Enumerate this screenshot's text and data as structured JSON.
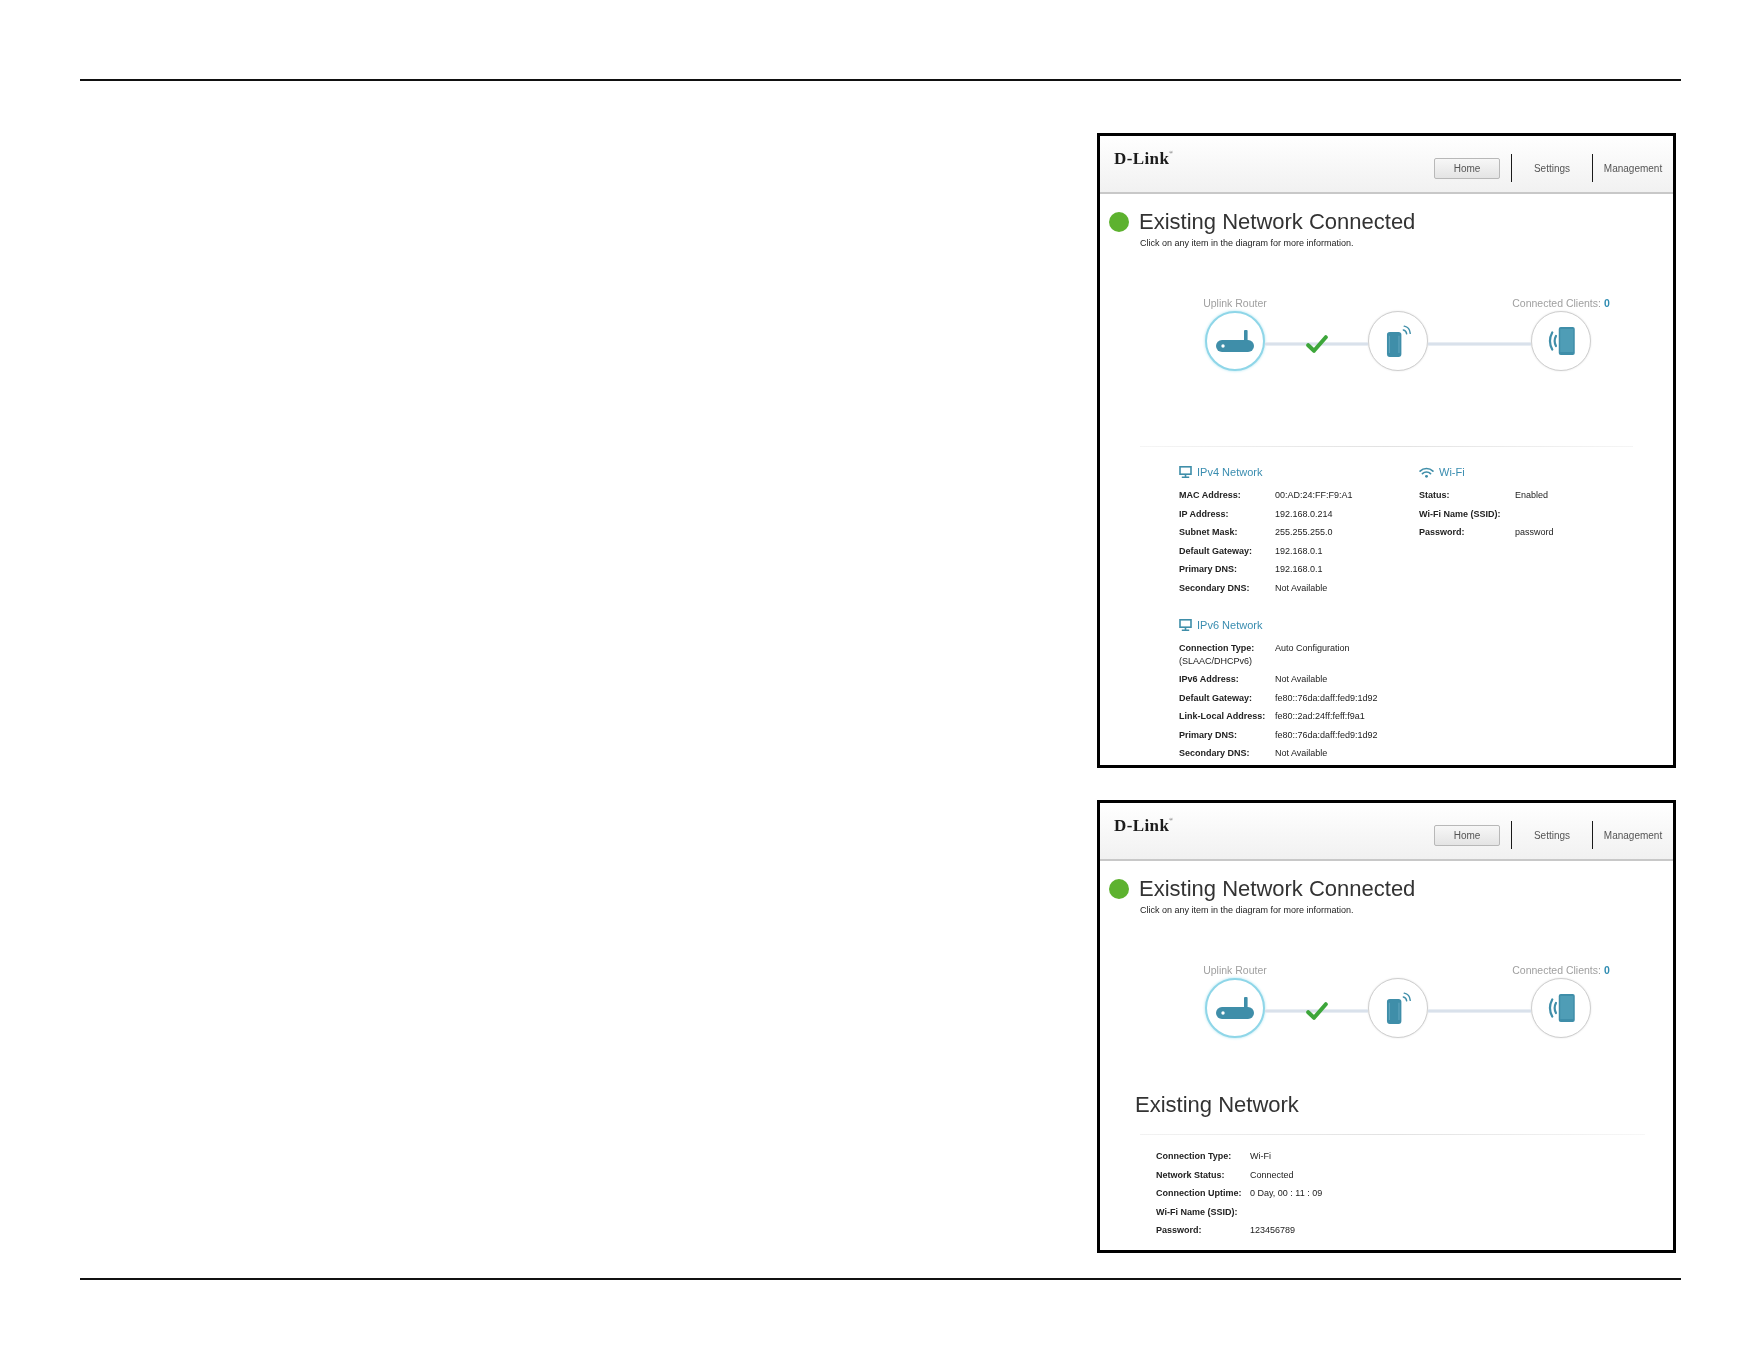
{
  "screenshots": [
    {
      "header": {
        "logo": "D-Link$^{®}$",
        "tabs": [
          {
            "label": "Home",
            "selected": true
          },
          {
            "label": "Settings",
            "selected": false
          },
          {
            "label": "Management",
            "selected": false
          }
        ]
      },
      "status": {
        "connected": true,
        "title": "Existing Network Connected",
        "subtitle": "Click on any item in the diagram for more information."
      },
      "diagram": {
        "nodes": [
          {
            "kind": "router",
            "label": "Uplink Router",
            "selected": true
          },
          {
            "kind": "extender",
            "selected": false
          },
          {
            "kind": "clients",
            "label": "Connected Clients:",
            "count": "0",
            "selected": false
          }
        ],
        "links": [
          {
            "checked": true
          },
          {
            "checked": false
          }
        ]
      },
      "details": {
        "columns": [
          {
            "sections": [
              {
                "kind": "wired",
                "title": "IPv4 Network",
                "rows": [
                  {
                    "label": "MAC Address:",
                    "value": "00:AD:24:FF:F9:A1"
                  },
                  {
                    "label": "IP Address:",
                    "value": "192.168.0.214"
                  },
                  {
                    "label": "Subnet Mask:",
                    "value": "255.255.255.0"
                  },
                  {
                    "label": "Default Gateway:",
                    "value": "192.168.0.1"
                  },
                  {
                    "label": "Primary DNS:",
                    "value": "192.168.0.1"
                  },
                  {
                    "label": "Secondary DNS:",
                    "value": "Not Available"
                  }
                ]
              },
              {
                "kind": "wired",
                "title": "IPv6 Network",
                "rows": [
                  {
                    "label": "Connection Type:",
                    "note": "(SLAAC/DHCPv6)",
                    "value": "Auto Configuration"
                  },
                  {
                    "label": "IPv6 Address:",
                    "value": "Not Available"
                  },
                  {
                    "label": "Default Gateway:",
                    "value": "fe80::76da:daff:fed9:1d92"
                  },
                  {
                    "label": "Link-Local Address:",
                    "value": "fe80::2ad:24ff:feff:f9a1"
                  },
                  {
                    "label": "Primary DNS:",
                    "value": "fe80::76da:daff:fed9:1d92"
                  },
                  {
                    "label": "Secondary DNS:",
                    "value": "Not Available"
                  }
                ]
              }
            ]
          },
          {
            "sections": [
              {
                "kind": "wifi",
                "title": "Wi-Fi",
                "rows": [
                  {
                    "label": "Status:",
                    "value": "Enabled"
                  },
                  {
                    "label": "Wi-Fi Name (SSID):"
                  },
                  {
                    "label": "Password:",
                    "value": "password"
                  }
                ]
              }
            ]
          }
        ]
      }
    },
    {
      "header": {
        "logo": "D-Link$^{®}$",
        "tabs": [
          {
            "label": "Home",
            "selected": true
          },
          {
            "label": "Settings",
            "selected": false
          },
          {
            "label": "Management",
            "selected": false
          }
        ]
      },
      "status": {
        "connected": true,
        "title": "Existing Network Connected",
        "subtitle": "Click on any item in the diagram for more information."
      },
      "diagram": {
        "nodes": [
          {
            "kind": "router",
            "label": "Uplink Router",
            "selected": true
          },
          {
            "kind": "extender",
            "selected": false
          },
          {
            "kind": "clients",
            "label": "Connected Clients:",
            "count": "0",
            "selected": false
          }
        ],
        "links": [
          {
            "checked": true
          },
          {
            "checked": false
          }
        ]
      },
      "existing_network": {
        "title": "Existing Network",
        "rows": [
          {
            "label": "Connection Type:",
            "value": "Wi-Fi"
          },
          {
            "label": "Network Status:",
            "value": "Connected"
          },
          {
            "label": "Connection Uptime:",
            "value": "0 Day, 00 : 11 : 09"
          },
          {
            "label": "Wi-Fi Name (SSID):"
          },
          {
            "label": "Password:",
            "value": "123456789"
          }
        ]
      }
    }
  ]
}
